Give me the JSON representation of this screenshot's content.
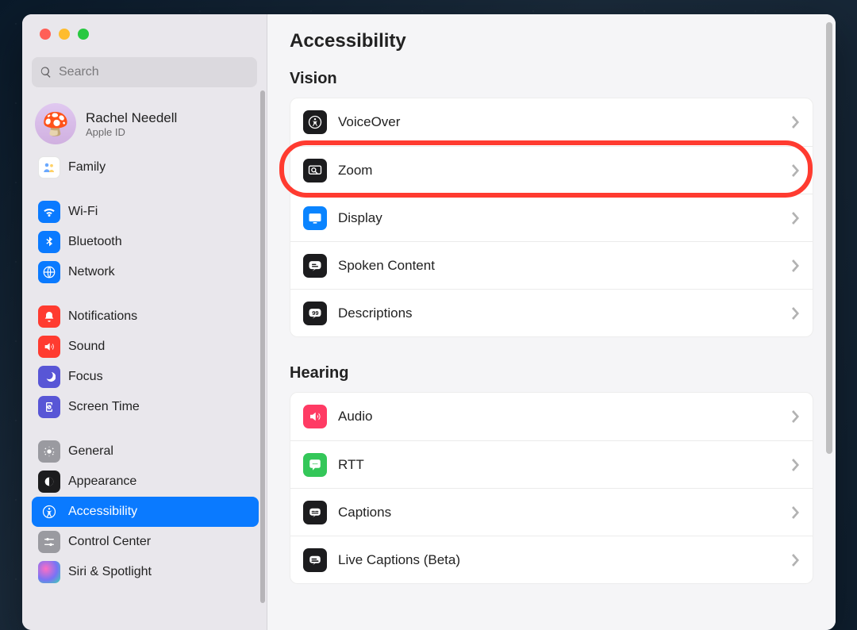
{
  "window": {
    "search_placeholder": "Search"
  },
  "account": {
    "name": "Rachel Needell",
    "subtitle": "Apple ID"
  },
  "sidebar": {
    "family": "Family",
    "wifi": "Wi-Fi",
    "bluetooth": "Bluetooth",
    "network": "Network",
    "notifications": "Notifications",
    "sound": "Sound",
    "focus": "Focus",
    "screen_time": "Screen Time",
    "general": "General",
    "appearance": "Appearance",
    "accessibility": "Accessibility",
    "control_center": "Control Center",
    "siri_spotlight": "Siri & Spotlight",
    "selected": "accessibility"
  },
  "page": {
    "title": "Accessibility",
    "sections": {
      "vision": {
        "title": "Vision",
        "voiceover": "VoiceOver",
        "zoom": "Zoom",
        "display": "Display",
        "spoken_content": "Spoken Content",
        "descriptions": "Descriptions"
      },
      "hearing": {
        "title": "Hearing",
        "audio": "Audio",
        "rtt": "RTT",
        "captions": "Captions",
        "live_captions": "Live Captions (Beta)"
      }
    },
    "highlighted_row": "zoom"
  }
}
